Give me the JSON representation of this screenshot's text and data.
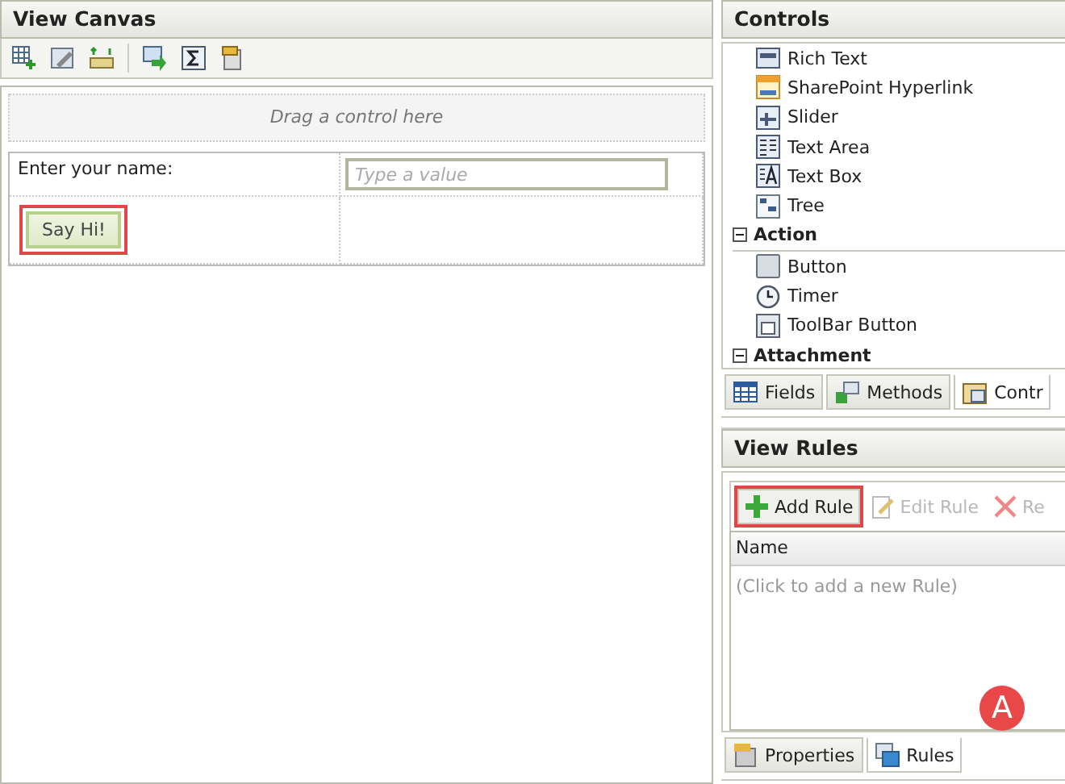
{
  "canvas": {
    "title": "View Canvas",
    "drop_zone": "Drag a control here",
    "form": {
      "label": "Enter your name:",
      "input_placeholder": "Type a value",
      "button": {
        "label": "Say Hi!",
        "highlighted": true
      }
    }
  },
  "controls": {
    "title": "Controls",
    "items": [
      {
        "kind": "item",
        "label": "Rich Text"
      },
      {
        "kind": "item",
        "label": "SharePoint Hyperlink"
      },
      {
        "kind": "item",
        "label": "Slider"
      },
      {
        "kind": "item",
        "label": "Text Area"
      },
      {
        "kind": "item",
        "label": "Text Box"
      },
      {
        "kind": "item",
        "label": "Tree"
      },
      {
        "kind": "group",
        "label": "Action",
        "expanded": true
      },
      {
        "kind": "item",
        "label": "Button"
      },
      {
        "kind": "item",
        "label": "Timer"
      },
      {
        "kind": "item",
        "label": "ToolBar Button"
      },
      {
        "kind": "group",
        "label": "Attachment",
        "expanded": true
      }
    ],
    "tabs": [
      {
        "label": "Fields",
        "selected": false
      },
      {
        "label": "Methods",
        "selected": false
      },
      {
        "label": "Contr",
        "selected": true
      }
    ]
  },
  "rules": {
    "title": "View Rules",
    "toolbar": [
      {
        "label": "Add Rule",
        "disabled": false,
        "highlighted": true
      },
      {
        "label": "Edit Rule",
        "disabled": true,
        "highlighted": false
      },
      {
        "label": "Re",
        "disabled": true,
        "highlighted": false
      }
    ],
    "column": "Name",
    "empty_text": "(Click to add a new Rule)",
    "tabs": [
      {
        "label": "Properties",
        "selected": false
      },
      {
        "label": "Rules",
        "selected": true
      }
    ],
    "badge": "A"
  }
}
